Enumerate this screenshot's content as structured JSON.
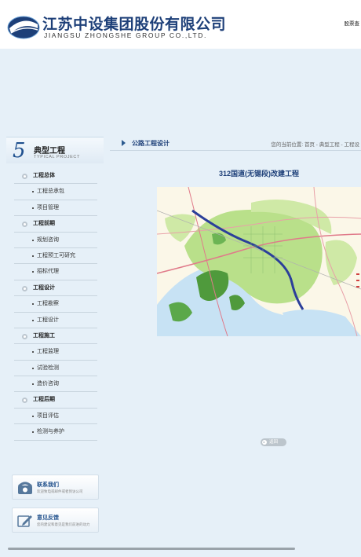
{
  "header": {
    "company_cn": "江苏中设集团股份有限公司",
    "company_en": "JIANGSU ZHONGSHE GROUP CO.,LTD.",
    "top_link": "股票查"
  },
  "sidebar": {
    "number": "5",
    "title": "典型工程",
    "title_en": "TYPICAL PROJECT",
    "menu": [
      {
        "type": "cat",
        "label": "工程总体"
      },
      {
        "type": "sub",
        "label": "工程总承包"
      },
      {
        "type": "sub",
        "label": "项目管理"
      },
      {
        "type": "cat",
        "label": "工程前期"
      },
      {
        "type": "sub",
        "label": "规划咨询"
      },
      {
        "type": "sub",
        "label": "工程预工可研究"
      },
      {
        "type": "sub",
        "label": "招标代理"
      },
      {
        "type": "cat",
        "label": "工程设计"
      },
      {
        "type": "sub",
        "label": "工程勘察"
      },
      {
        "type": "sub",
        "label": "工程设计"
      },
      {
        "type": "cat",
        "label": "工程施工"
      },
      {
        "type": "sub",
        "label": "工程监理"
      },
      {
        "type": "sub",
        "label": "试验检测"
      },
      {
        "type": "sub",
        "label": "造价咨询"
      },
      {
        "type": "cat",
        "label": "工程后期"
      },
      {
        "type": "sub",
        "label": "项目评估"
      },
      {
        "type": "sub",
        "label": "检测与养护"
      }
    ],
    "contact_card": {
      "title": "联系我们",
      "subtitle": "欢迎致电或邮件或者到访公司"
    },
    "feedback_card": {
      "title": "意见反馈",
      "subtitle": "您的建议和意见是我们前进的动力"
    }
  },
  "main": {
    "section_title": "公路工程设计",
    "breadcrumb": "您的当前位置: 首页 - 典型工程 - 工程设",
    "article_title": "312国道(无锡段)改建工程",
    "back_label": "返回"
  },
  "colors": {
    "brand_blue": "#1d3f78",
    "page_bg": "#e6f0f8"
  }
}
